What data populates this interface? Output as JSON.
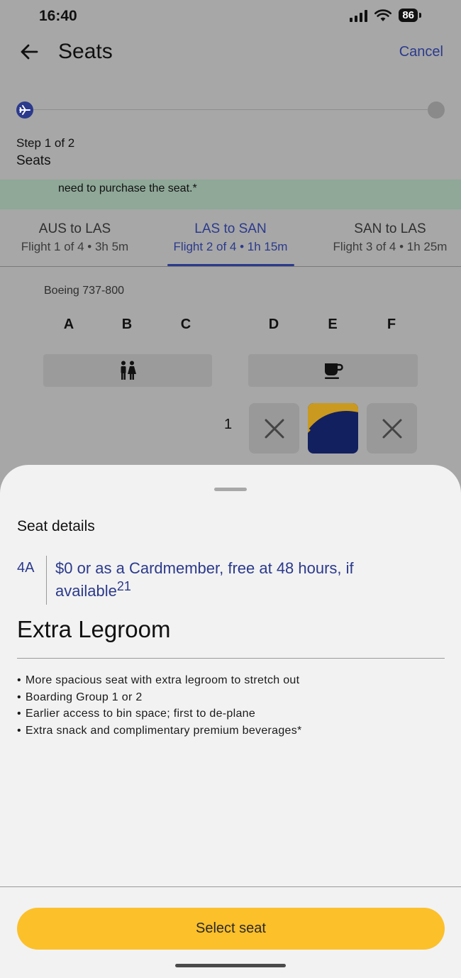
{
  "status_bar": {
    "time": "16:40",
    "battery": "86"
  },
  "header": {
    "title": "Seats",
    "cancel_label": "Cancel"
  },
  "progress": {
    "step_label": "Step 1 of 2",
    "step_name": "Seats"
  },
  "info_banner": {
    "text": "need to purchase the seat.*"
  },
  "flight_tabs": [
    {
      "route": "AUS to LAS",
      "meta": "Flight 1 of 4 • 3h 5m",
      "active": false
    },
    {
      "route": "LAS to SAN",
      "meta": "Flight 2 of 4 • 1h 15m",
      "active": true
    },
    {
      "route": "SAN to LAS",
      "meta": "Flight 3 of 4 • 1h 25m",
      "active": false
    }
  ],
  "seat_map": {
    "aircraft": "Boeing 737-800",
    "columns": [
      "A",
      "B",
      "C",
      "D",
      "E",
      "F"
    ],
    "amenities": [
      "restroom-icon",
      "coffee-icon"
    ],
    "row_number": "1",
    "row_seats": [
      "unavailable",
      "premium",
      "unavailable"
    ]
  },
  "seat_details": {
    "title": "Seat details",
    "seat_id": "4A",
    "price_text": "$0 or as a Cardmember, free at 48 hours, if available",
    "price_footnote": "21",
    "seat_class": "Extra Legroom",
    "features": [
      "More spacious seat with extra legroom to stretch out",
      "Boarding Group 1 or 2",
      "Earlier access to bin space; first to de-plane",
      "Extra snack and complimentary premium beverages*"
    ],
    "select_label": "Select seat"
  },
  "colors": {
    "accent": "#2b3a8c",
    "button": "#fcc02a",
    "banner": "#8fa898",
    "premium_seat": "#13205f",
    "premium_stripe": "#c99a1f"
  }
}
